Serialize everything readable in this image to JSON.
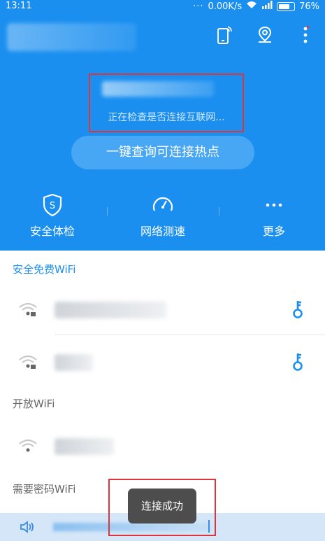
{
  "status_bar": {
    "time": "13:11",
    "network_speed": "0.00K/s",
    "battery": "76%"
  },
  "current_connection": {
    "status": "正在检查是否连接互联网..."
  },
  "query_button": {
    "label": "一键查询可连接热点"
  },
  "features": [
    {
      "label": "安全体检",
      "icon": "shield-icon"
    },
    {
      "label": "网络测速",
      "icon": "speedometer-icon"
    },
    {
      "label": "更多",
      "icon": "more-dots-icon"
    }
  ],
  "sections": {
    "secure_free": "安全免费WiFi",
    "open": "开放WiFi",
    "password_required": "需要密码WiFi"
  },
  "toast": {
    "text": "连接成功"
  },
  "colors": {
    "primary_blue": "#1a8ff0",
    "accent_blue": "#47a7f4",
    "highlight_red": "#d9363e",
    "section_blue": "#1a8ff0"
  }
}
